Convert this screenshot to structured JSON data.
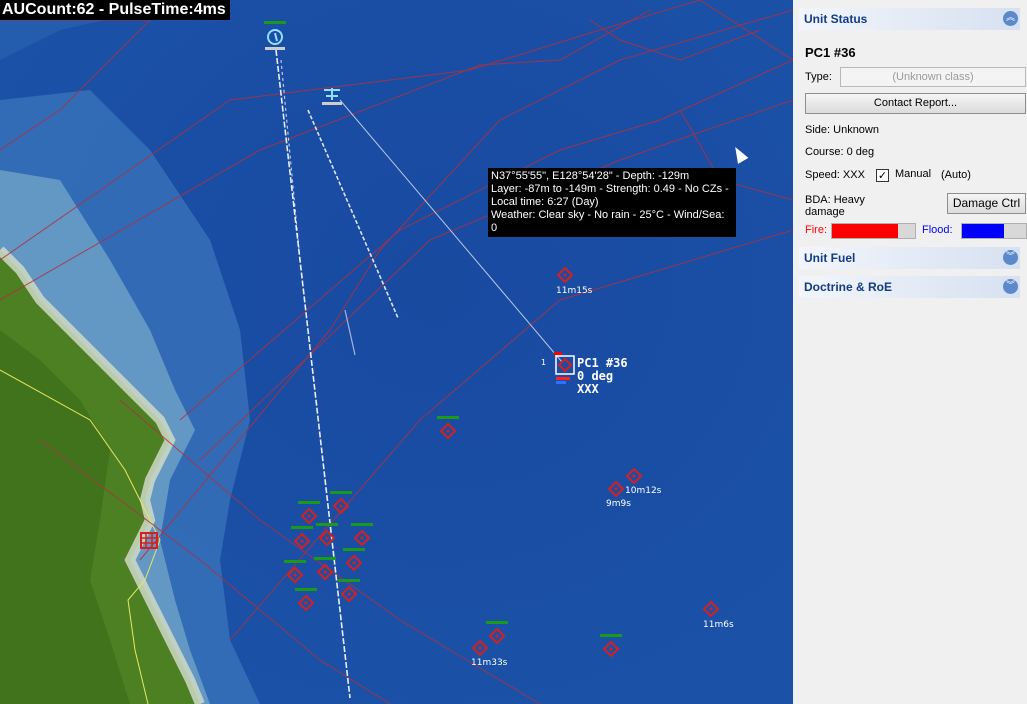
{
  "hud": {
    "text": "AUCount:62 - PulseTime:4ms"
  },
  "tooltip": {
    "lines": [
      "N37°55'55\", E128°54'28\" - Depth: -129m",
      "Layer: -87m to -149m - Strength: 0.49 - No CZs -",
      "Local time: 6:27 (Day)",
      "Weather: Clear sky - No rain - 25°C - Wind/Sea: 0"
    ]
  },
  "selected_unit": {
    "index": "1",
    "name": "PC1 #36",
    "heading": "0 deg",
    "alt": "XXX"
  },
  "contact_labels": [
    "11m15s",
    "10m12s",
    "9m9s",
    "11m6s",
    "11m33s"
  ],
  "panel": {
    "unit_status": {
      "header": "Unit Status",
      "unit_name": "PC1 #36",
      "type_label": "Type:",
      "type_placeholder": "(Unknown class)",
      "contact_report": "Contact Report...",
      "side": "Side: Unknown",
      "course": "Course: 0 deg",
      "speed": "Speed: XXX",
      "manual_label": "Manual",
      "manual_checked": true,
      "auto_label": "(Auto)",
      "bda_label": "BDA: Heavy damage",
      "damage_ctrl": "Damage Ctrl",
      "fire_label": "Fire:",
      "fire_level": 0.8,
      "flood_label": "Flood:",
      "flood_level": 0.65
    },
    "unit_fuel": {
      "header": "Unit Fuel"
    },
    "doctrine": {
      "header": "Doctrine & RoE"
    }
  },
  "colors": {
    "sea": "#1a4fa0",
    "land": "#4c8023",
    "contact": "#d42020",
    "friendly_bar": "#1a9a1a",
    "fire": "#ff0000",
    "flood": "#0000ff",
    "panel_header_text": "#123c84"
  }
}
